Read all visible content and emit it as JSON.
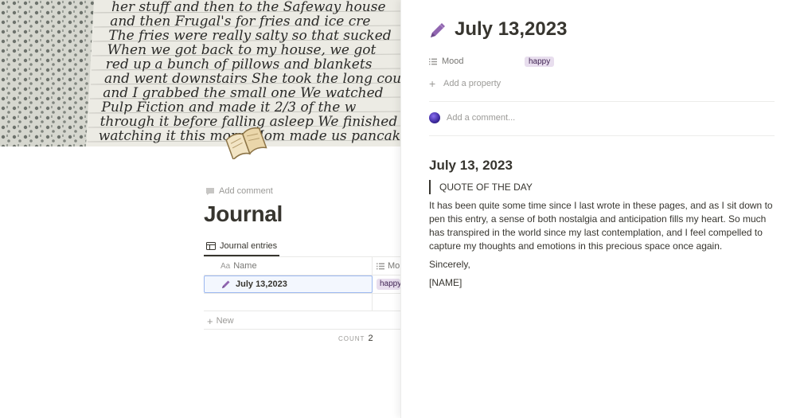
{
  "cover": {
    "handwriting_lines": [
      "her stuff and then to the Safeway house",
      "and then Frugal's for fries and ice cre",
      "The fries were really salty so that sucked",
      "When we got back to my house, we got",
      "red up a bunch of pillows and blankets",
      "and went downstairs She took the long couc",
      "and I grabbed the small one We watched",
      "Pulp Fiction and made it 2/3 of the w",
      "through it before falling asleep We finished",
      "watching it this morn Mom made us pancak"
    ],
    "icon": "open-book-icon"
  },
  "page": {
    "add_comment": "Add comment",
    "title": "Journal",
    "view_tab": "Journal entries"
  },
  "table": {
    "columns": [
      {
        "icon": "text-icon",
        "icon_text": "Aa",
        "label": "Name"
      },
      {
        "icon": "list-icon",
        "label": "Mo"
      }
    ],
    "rows": [
      {
        "name": "July 13,2023",
        "mood": "happy",
        "icon": "pencil-icon"
      }
    ],
    "new_label": "New",
    "count_label": "COUNT",
    "count_value": "2"
  },
  "panel": {
    "title": "July 13,2023",
    "title_icon": "pencil-icon",
    "properties": [
      {
        "key": "Mood",
        "icon": "list-icon",
        "value": "happy"
      }
    ],
    "add_property": "Add a property",
    "comment_placeholder": "Add a comment...",
    "doc": {
      "heading": "July 13, 2023",
      "quote": "QUOTE OF THE DAY",
      "paragraph": "It has been quite some time since I last wrote in these pages, and as I sit down to pen this entry, a sense of both nostalgia and anticipation fills my heart. So much has transpired in the world since my last contemplation, and I feel compelled to capture my thoughts and emotions in this precious space once again.",
      "closing": "Sincerely,",
      "signature": "[NAME]"
    }
  },
  "colors": {
    "accent_purple": "#9065b0",
    "tag_bg": "#e8deee",
    "tag_text": "#412454",
    "selection_border": "#9cb8f0"
  }
}
